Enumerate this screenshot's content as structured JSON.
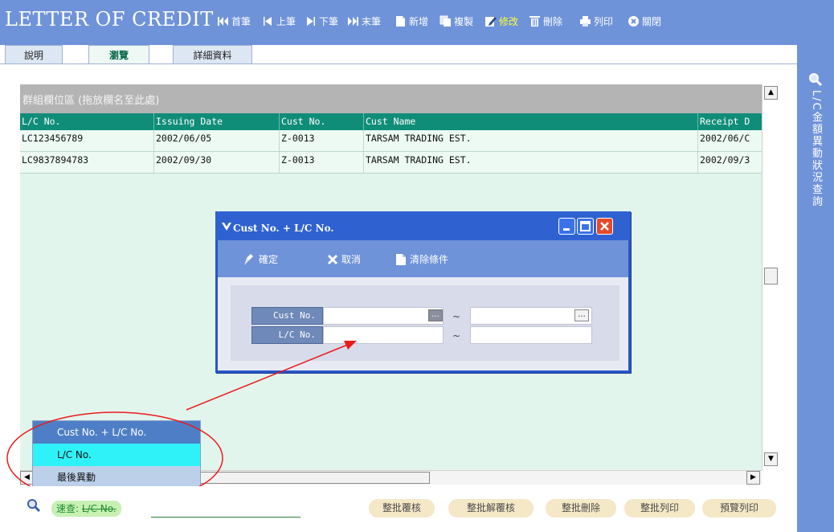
{
  "app": {
    "title": "LETTER OF CREDIT",
    "toolbar": {
      "first": "首筆",
      "prev": "上筆",
      "next": "下筆",
      "last": "末筆",
      "add": "新增",
      "copy": "複製",
      "edit": "修改",
      "delete": "刪除",
      "print": "列印",
      "close": "關閉"
    },
    "icons": {
      "first": "first-record-icon",
      "prev": "previous-record-icon",
      "next": "next-record-icon",
      "last": "last-record-icon",
      "add": "new-document-icon",
      "copy": "copy-icon",
      "edit": "edit-icon",
      "delete": "trash-icon",
      "print": "printer-icon",
      "close": "close-circle-icon"
    },
    "colors": {
      "toolbar": "#6f93d9",
      "edit_label": "#ffff33",
      "grid_header": "#108d79"
    }
  },
  "tabs": [
    {
      "label": "說明"
    },
    {
      "label": "瀏覽"
    },
    {
      "label": "詳細資料"
    }
  ],
  "side_panel": {
    "label": "L/C金額異動狀況查詢",
    "icon": "magnifier-icon"
  },
  "grid": {
    "group_hint": "群組欄位區 (拖放欄名至此處)",
    "columns": [
      "L/C No.",
      "Issuing Date",
      "Cust No.",
      "Cust Name",
      "Receipt D"
    ],
    "rows": [
      [
        "LC123456789",
        "2002/06/05",
        "Z-0013",
        "TARSAM TRADING EST.",
        "2002/06/C"
      ],
      [
        "LC9837894783",
        "2002/09/30",
        "Z-0013",
        "TARSAM TRADING EST.",
        "2002/09/3"
      ]
    ]
  },
  "dialog": {
    "title": "Cust No. + L/C No.",
    "buttons": {
      "ok": "確定",
      "cancel": "取消",
      "clear": "清除條件"
    },
    "fields": {
      "cust_no": {
        "label": "Cust No.",
        "from": "",
        "to": ""
      },
      "lc_no": {
        "label": "L/C No.",
        "from": "",
        "to": ""
      },
      "range_sep": "~",
      "lookup": "..."
    }
  },
  "dropdown": {
    "items": [
      "Cust No. + L/C No.",
      "L/C No.",
      "最後異動"
    ],
    "selected": "L/C No."
  },
  "bottom": {
    "quick_prefix": "速查:",
    "quick_field": "L/C No.",
    "quick_value": "",
    "buttons": [
      "整批覆核",
      "整批解覆核",
      "整批刪除",
      "整批列印",
      "預覽列印"
    ]
  }
}
